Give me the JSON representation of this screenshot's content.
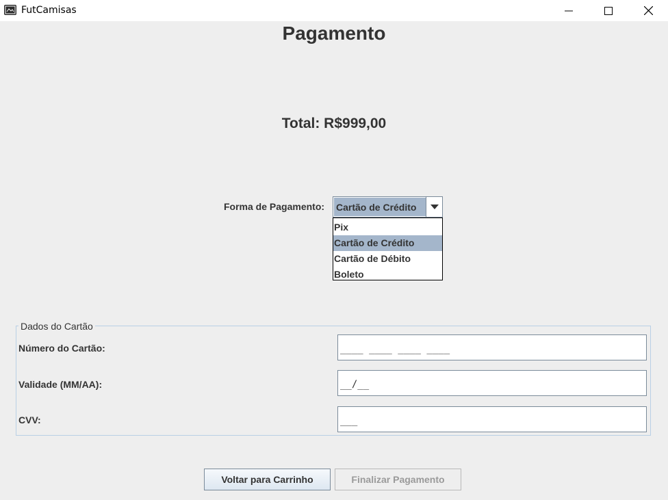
{
  "window": {
    "title": "FutCamisas"
  },
  "page": {
    "title": "Pagamento",
    "total": "Total: R$999,00"
  },
  "payment": {
    "label": "Forma de Pagamento:",
    "selected": "Cartão de Crédito",
    "options": [
      "Pix",
      "Cartão de Crédito",
      "Cartão de Débito",
      "Boleto"
    ]
  },
  "card": {
    "legend": "Dados do Cartão",
    "number_label": "Número do Cartão:",
    "number_value": "____ ____ ____ ____",
    "validity_label": "Validade (MM/AA):",
    "validity_value": "__/__",
    "cvv_label": "CVV:",
    "cvv_value": "___"
  },
  "buttons": {
    "back": "Voltar para Carrinho",
    "finish": "Finalizar Pagamento"
  },
  "colors": {
    "background": "#eeeeee",
    "selection": "#a4b6cb",
    "group_border": "#b8cfe5",
    "disabled_text": "#9a9a9a"
  },
  "icons": [
    "app-icon",
    "minimize-icon",
    "maximize-icon",
    "close-icon",
    "chevron-down-icon"
  ]
}
